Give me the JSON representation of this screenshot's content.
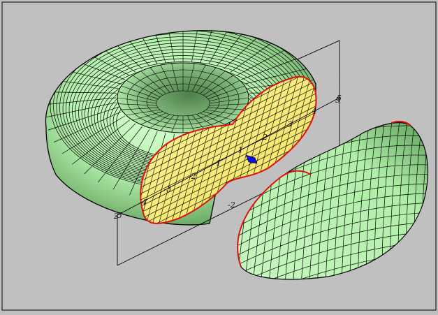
{
  "figure": {
    "background_color": "#c0c0c0",
    "frame_color": "#000000",
    "surface_outer_color": "#b8f3b0",
    "surface_outer_shadow": "#5f9f5a",
    "cross_section_color": "#fff27a",
    "cross_section_edge": "#e01010",
    "marker_color": "#1010e0",
    "grid_line_color": "#000000"
  },
  "axis_ticks": {
    "plane_axis_main": [
      "-5",
      "-4",
      "-3",
      "-2",
      "-1",
      "1",
      "2",
      "3",
      "4",
      "5"
    ],
    "plane_axis_secondary": [
      "-2",
      "5"
    ],
    "plane_axis_side": [
      "2"
    ]
  }
}
